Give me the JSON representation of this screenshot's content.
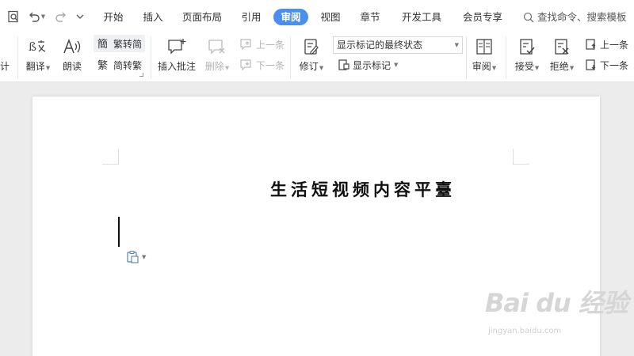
{
  "menubar": {
    "tabs": [
      {
        "label": "开始"
      },
      {
        "label": "插入"
      },
      {
        "label": "页面布局"
      },
      {
        "label": "引用"
      },
      {
        "label": "审阅",
        "active": true
      },
      {
        "label": "视图"
      },
      {
        "label": "章节"
      },
      {
        "label": "开发工具"
      },
      {
        "label": "会员专享"
      }
    ],
    "search_text": "查找命令、搜索模板"
  },
  "ribbon": {
    "left_clipped_label": "计",
    "translate_label": "翻译",
    "read_aloud_label": "朗读",
    "trad_to_simp_label": "繁转简",
    "simp_to_trad_label": "简转繁",
    "insert_comment_label": "插入批注",
    "delete_label": "删除",
    "prev_comment_label": "上一条",
    "next_comment_label": "下一条",
    "track_changes_label": "修订",
    "display_mode_value": "显示标记的最终状态",
    "show_markup_label": "显示标记",
    "review_label": "审阅",
    "accept_label": "接受",
    "reject_label": "拒绝",
    "prev_change_label": "上一条",
    "next_change_label": "下一条"
  },
  "document": {
    "title": "生活短视频内容平臺"
  },
  "watermark": {
    "logo": "Bai  du 经验",
    "url": "jingyan.baidu.com"
  },
  "colors": {
    "accent": "#4a8ff0",
    "ribbon_bg": "#ffffff",
    "canvas_bg": "#ececec",
    "disabled": "#b4b4b4"
  },
  "icons": [
    "print-preview-icon",
    "undo-icon",
    "redo-icon",
    "customize-icon",
    "search-icon",
    "translate-icon",
    "read-aloud-icon",
    "trad-to-simp-icon",
    "simp-to-trad-icon",
    "insert-comment-icon",
    "delete-comment-icon",
    "prev-comment-icon",
    "next-comment-icon",
    "track-changes-icon",
    "show-markup-icon",
    "review-pane-icon",
    "accept-icon",
    "reject-icon",
    "prev-change-icon",
    "next-change-icon",
    "paste-options-icon"
  ]
}
